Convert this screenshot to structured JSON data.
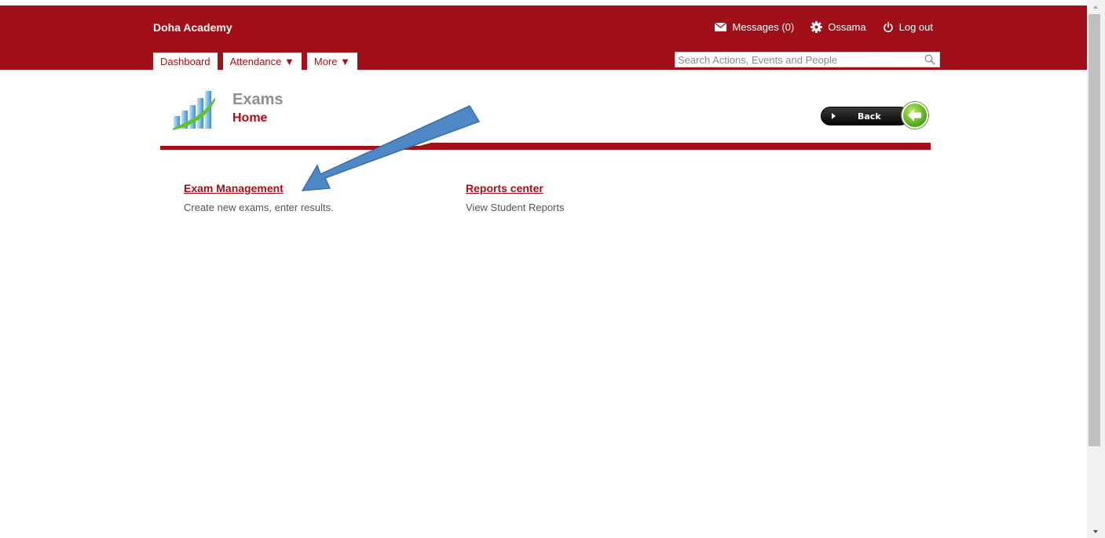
{
  "header": {
    "brand": "Doha Academy",
    "messages_label": "Messages (0)",
    "user_label": "Ossama",
    "logout_label": "Log out",
    "tabs": [
      {
        "label": "Dashboard"
      },
      {
        "label": "Attendance ▼"
      },
      {
        "label": "More ▼"
      }
    ],
    "search": {
      "placeholder": "Search Actions, Events and People",
      "value": ""
    }
  },
  "page": {
    "title": "Exams",
    "subtitle": "Home",
    "back_label": "Back"
  },
  "links": [
    {
      "title": "Exam Management",
      "desc": "Create new exams, enter results."
    },
    {
      "title": "Reports center",
      "desc": "View Student Reports"
    }
  ],
  "colors": {
    "brand": "#a3101a",
    "annotation_arrow": "#4f88c6"
  },
  "icons": [
    "envelope-icon",
    "gear-icon",
    "power-icon",
    "search-icon",
    "chart-logo-icon",
    "back-arrow-icon"
  ]
}
